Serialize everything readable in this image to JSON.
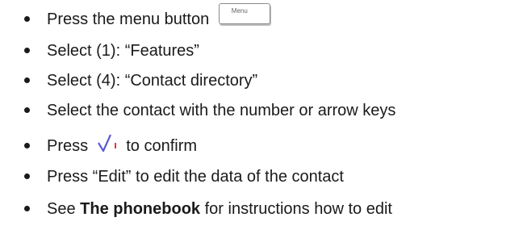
{
  "steps": [
    {
      "before": "Press the menu button",
      "icon": "menu-key-icon",
      "icon_label": "Menu"
    },
    {
      "text": "Select (1): “Features”"
    },
    {
      "text": "Select (4): “Contact directory”"
    },
    {
      "text": "Select the contact with the number or arrow keys"
    },
    {
      "before": "Press",
      "icon": "check-icon",
      "after": "to confirm"
    },
    {
      "text": "Press “Edit” to edit the data of the contact"
    },
    {
      "before": "See",
      "bold": "The phonebook",
      "after": "for instructions how to edit"
    }
  ],
  "colors": {
    "text": "#1a1a1a",
    "check_mark": "#5b5bd6",
    "check_tick": "#e03c31"
  }
}
